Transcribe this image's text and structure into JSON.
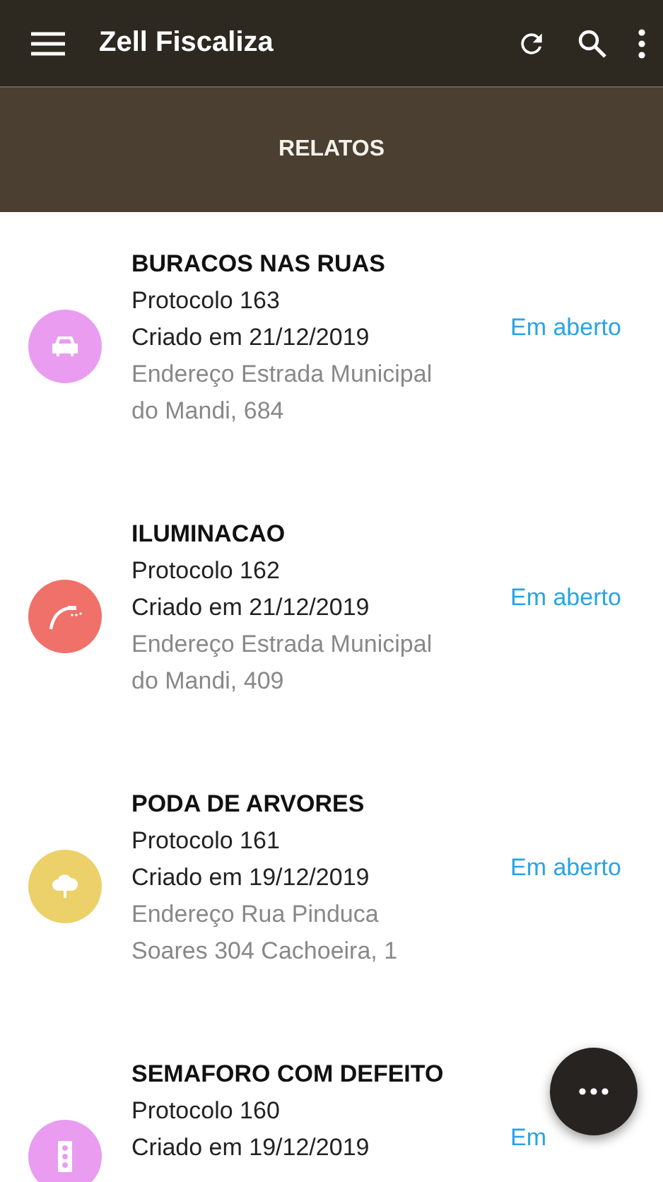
{
  "app_bar": {
    "title": "Zell Fiscaliza"
  },
  "tabs": [
    {
      "label": "RELATOS",
      "selected": true
    }
  ],
  "reports": [
    {
      "kind": "car",
      "color": "#e99cf0",
      "title": "BURACOS NAS RUAS",
      "protocol": "Protocolo 163",
      "created": "Criado em 21/12/2019",
      "address": "Endereço Estrada Municipal do Mandi, 684",
      "status": "Em aberto"
    },
    {
      "kind": "streetlight",
      "color": "#f0706a",
      "title": "ILUMINACAO",
      "protocol": "Protocolo 162",
      "created": "Criado em 21/12/2019",
      "address": "Endereço Estrada Municipal do Mandi, 409",
      "status": "Em aberto"
    },
    {
      "kind": "tree",
      "color": "#ecd06a",
      "title": "PODA DE ARVORES",
      "protocol": "Protocolo 161",
      "created": "Criado em 19/12/2019",
      "address": "Endereço Rua Pinduca Soares 304 Cachoeira, 1",
      "status": "Em aberto"
    },
    {
      "kind": "traffic_light",
      "color": "#e99cf0",
      "title": "SEMAFORO COM DEFEITO",
      "protocol": "Protocolo 160",
      "created": "Criado em 19/12/2019",
      "status": "Em"
    }
  ]
}
